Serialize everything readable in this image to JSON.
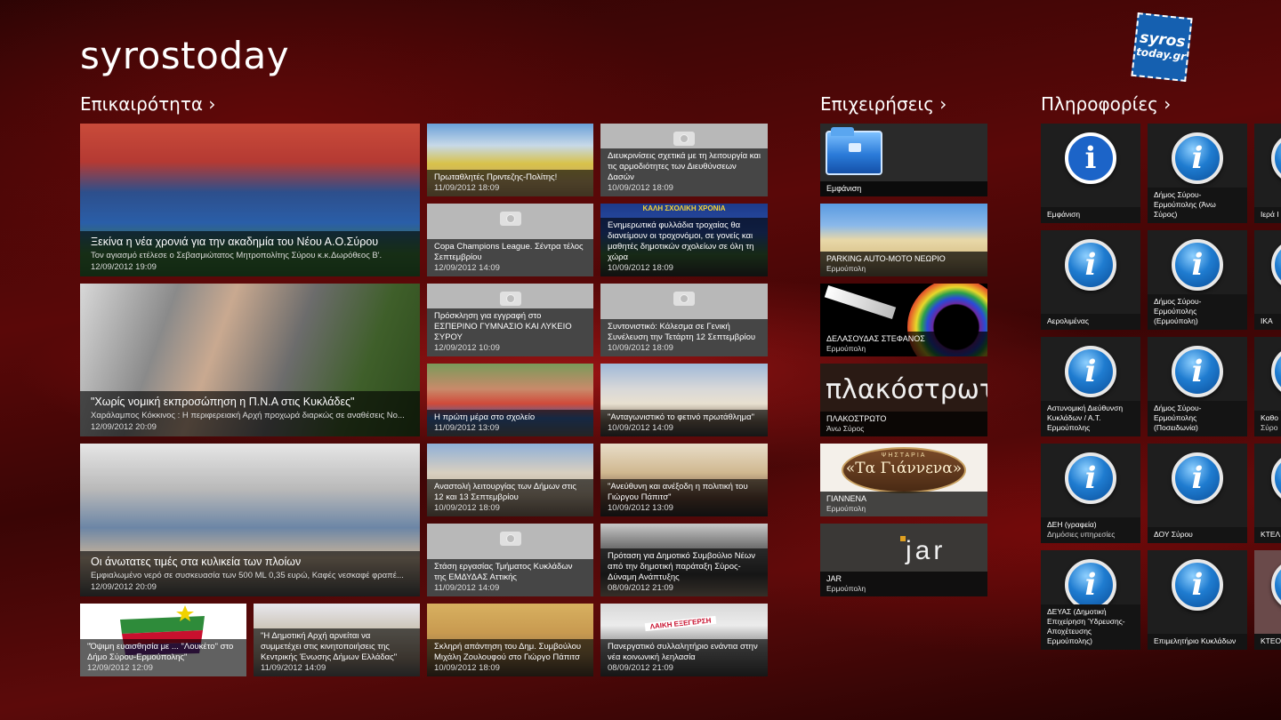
{
  "app": {
    "title": "syrostoday",
    "logo_line1": "syros",
    "logo_line2": "today.gr"
  },
  "sections": {
    "news": "Επικαιρότητα ›",
    "business": "Επιχειρήσεις ›",
    "info": "Πληροφορίες ›"
  },
  "news": [
    {
      "title": "Ξεκίνα η νέα χρονιά για την ακαδημία του Νέου Α.Ο.Σύρου",
      "summary": "Τον αγιασμό ετέλεσε ο Σεβασμιώτατος Μητροπολίτης Σύρου κ.κ.Δωρόθεος Β'.",
      "date": "12/09/2012 19:09"
    },
    {
      "title": "\"Χωρίς νομική εκπροσώπηση η Π.Ν.Α στις Κυκλάδες\"",
      "summary": "Χαράλαμπος Κόκκινος : Η περιφερειακή Αρχή προχωρά διαρκώς σε αναθέσεις Νο...",
      "date": "12/09/2012 20:09"
    },
    {
      "title": "Οι άνωτατες τιμές στα κυλικεία των πλοίων",
      "summary": "Εμφιαλωμένο νερό σε συσκευασία των 500 ML 0,35 ευρώ, Καφές νεσκαφέ φραπέ...",
      "date": "12/09/2012 20:09"
    },
    {
      "title": "Πρωταθλητές Πριντεζης-Πολίτης!",
      "date": "11/09/2012 18:09"
    },
    {
      "title": "Διευκρινίσεις σχετικά με τη λειτουργία και τις αρμοδιότητες των Διευθύνσεων Δασών",
      "date": "10/09/2012 18:09"
    },
    {
      "title": "Copa Champions League. Σέντρα τέλος Σεπτεμβρίου",
      "date": "12/09/2012 14:09"
    },
    {
      "title": "Ενημερωτικά φυλλάδια τροχαίας θα διανείμουν οι τροχονόμοι, σε γονείς και μαθητές δημοτικών σχολείων σε όλη τη χώρα",
      "date": "10/09/2012 18:09",
      "banner": "ΚΑΛΗ ΣΧΟΛΙΚΗ ΧΡΟΝΙΑ"
    },
    {
      "title": "Πρόσκληση για εγγραφή στο ΕΣΠΕΡΙΝΟ ΓΥΜΝΑΣΙΟ ΚΑΙ ΛΥΚΕΙΟ ΣΥΡΟΥ",
      "date": "12/09/2012 10:09"
    },
    {
      "title": "Συντονιστικό: Κάλεσμα σε Γενική Συνέλευση την Τετάρτη 12 Σεπτεμβρίου",
      "date": "10/09/2012 18:09"
    },
    {
      "title": "Η πρώτη μέρα στο σχολείο",
      "date": "11/09/2012 13:09"
    },
    {
      "title": "\"Ανταγωνιστικό το φετινό πρωτάθλημα\"",
      "date": "10/09/2012 14:09"
    },
    {
      "title": "Αναστολή λειτουργίας των Δήμων στις 12 και 13 Σεπτεμβρίου",
      "date": "10/09/2012 18:09"
    },
    {
      "title": "\"Ανεύθυνη και ανέξοδη η πολιτική του Γιώργου Πάπιτσ\"",
      "date": "10/09/2012 13:09"
    },
    {
      "title": "Στάση εργασίας Τμήματος Κυκλάδων της ΕΜΔΥΔΑΣ Αττικής",
      "date": "11/09/2012 14:09"
    },
    {
      "title": "Πρόταση για Δημοτικό Συμβούλιο Νέων από την δημοτική παράταξη Σύρος-Δύναμη Ανάπτυξης",
      "date": "08/09/2012 21:09"
    },
    {
      "title": "\"Όψιμη ευαισθησία με ... \"Λουκέτο\" στο Δήμο Σύρου-Ερμούπολης\"",
      "date": "12/09/2012 12:09"
    },
    {
      "title": "\"Η Δημοτική Αρχή αρνείται να συμμετέχει στις κινητοποιήσεις της Κεντρικής Ένωσης Δήμων Ελλάδας\"",
      "date": "11/09/2012 14:09"
    },
    {
      "title": "Σκληρή απάντηση του Δημ. Συμβούλου Μιχάλη Ζουλουφού στο Γιώργο Πάπιτσ",
      "date": "10/09/2012 18:09"
    },
    {
      "title": "Πανεργατικό συλλαλητήριο ενάντια στην νέα κοινωνική λεηλασία",
      "date": "08/09/2012 21:09",
      "banner": "ΛΑΙΚΗ ΕΞΕΓΕΡΣΗ"
    }
  ],
  "businesses": [
    {
      "name": "Εμφάνιση",
      "area": ""
    },
    {
      "name": "PARKING AUTO-MOTO ΝΕΩΡΙΟ",
      "area": "Ερμούπολη"
    },
    {
      "name": "ΔΕΛΑΣΟΥΔΑΣ ΣΤΕΦΑΝΟΣ",
      "area": "Ερμούπολη"
    },
    {
      "name": "ΠΛΑΚΟΣΤΡΩΤΟ",
      "area": "Άνω Σύρος",
      "logo": "πλακόστρωτο"
    },
    {
      "name": "ΓΙΑΝΝΕΝΑ",
      "area": "Ερμούπολη",
      "logo": "«Τα Γιάννενα»",
      "logo_top": "ΨΗΣΤΑΡΙΑ"
    },
    {
      "name": "JAR",
      "area": "Ερμούπολη",
      "logo": "jar"
    }
  ],
  "info": {
    "icon_letter": "i",
    "col1": [
      {
        "label": "Εμφάνιση",
        "sub": ""
      },
      {
        "label": "Αερολιμένας",
        "sub": ""
      },
      {
        "label": "Αστυνομική Διεύθυνση Κυκλάδων / Α.Τ. Ερμούπολης",
        "sub": ""
      },
      {
        "label": "ΔΕΗ (γραφεία)",
        "sub": "Δημόσιες υπηρεσίες"
      },
      {
        "label": "ΔΕΥΑΣ (Δημοτική Επιχείρηση Ύδρευσης-Αποχέτευσης Ερμούπολης)",
        "sub": ""
      }
    ],
    "col2": [
      {
        "label": "Δήμος Σύρου-Ερμούπολης (Άνω Σύρος)",
        "sub": ""
      },
      {
        "label": "Δήμος Σύρου-Ερμούπολης (Ερμούπολη)",
        "sub": ""
      },
      {
        "label": "Δήμος Σύρου-Ερμούπολης (Ποσειδωνία)",
        "sub": ""
      },
      {
        "label": "ΔΟΥ Σύρου",
        "sub": ""
      },
      {
        "label": "Επιμελητήριο Κυκλάδων",
        "sub": ""
      }
    ],
    "col3": [
      {
        "label": "Ιερά Ι",
        "sub": ""
      },
      {
        "label": "ΙΚΑ",
        "sub": ""
      },
      {
        "label": "Καθο",
        "sub": "Σύρο"
      },
      {
        "label": "ΚΤΕΛ",
        "sub": ""
      },
      {
        "label": "ΚΤΕΟ",
        "sub": ""
      }
    ]
  }
}
